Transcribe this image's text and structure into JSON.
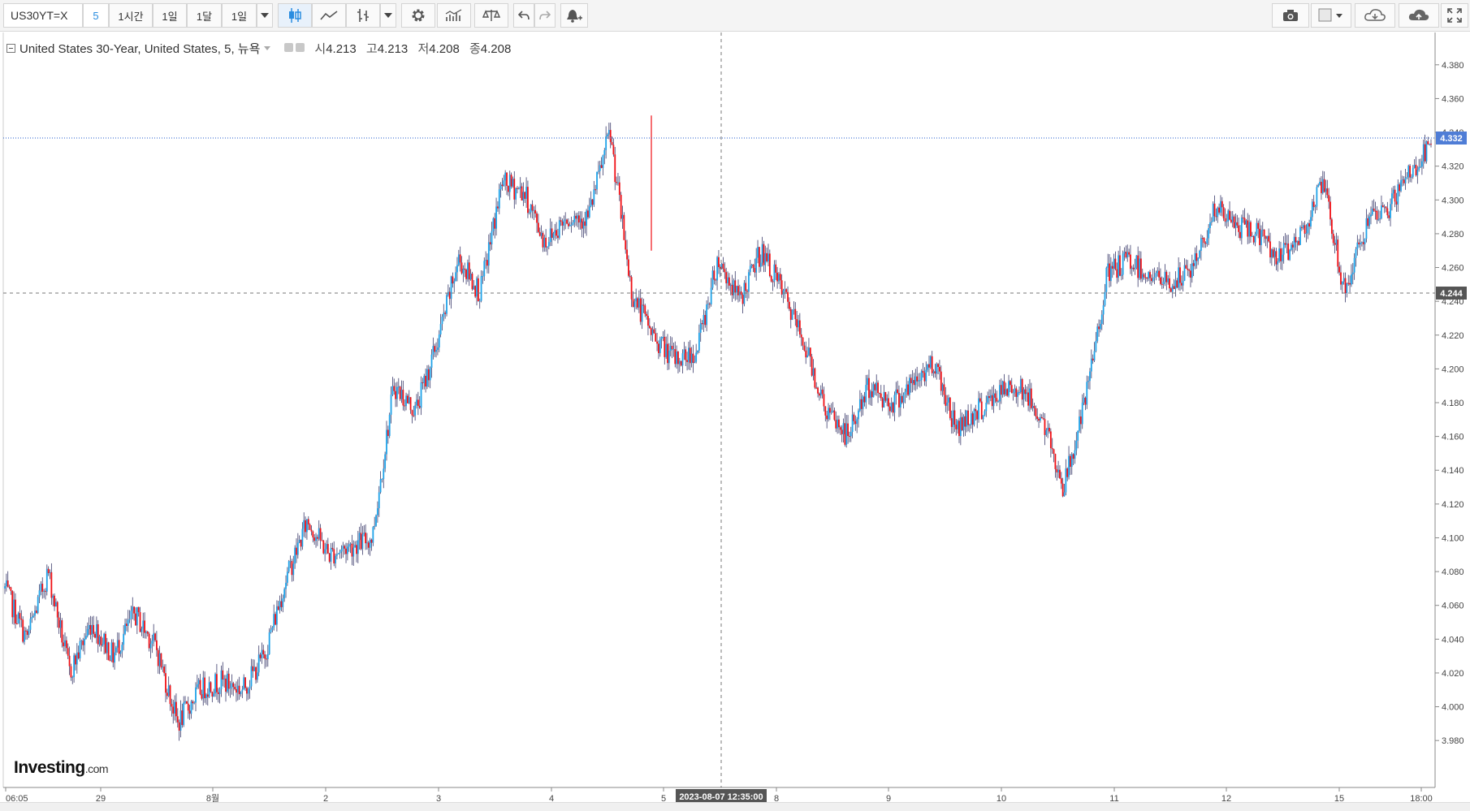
{
  "toolbar": {
    "symbol": "US30YT=X",
    "interval_active": "5",
    "intervals": [
      "1시간",
      "1일",
      "1달",
      "1일"
    ]
  },
  "legend": {
    "title": "United States 30-Year, United States, 5, 뉴욕",
    "open_label": "시",
    "open": "4.213",
    "high_label": "고",
    "high": "4.213",
    "low_label": "저",
    "low": "4.208",
    "close_label": "종",
    "close": "4.208"
  },
  "crosshair": {
    "date_label": "2023-08-07 12:35:00",
    "price_label": "4.244"
  },
  "last_price": "4.332",
  "logo": {
    "main": "Investing",
    "suffix": ".com"
  },
  "colors": {
    "up": "#1ea2e8",
    "down": "#f00f14",
    "wick": "#3b3b6b",
    "last_price_bg": "#4f7dd6",
    "crosshair_bg": "#555555"
  },
  "chart_data": {
    "type": "candlestick",
    "ylim": [
      3.97,
      4.39
    ],
    "y_ticks": [
      "4.380",
      "4.360",
      "4.340",
      "4.320",
      "4.300",
      "4.280",
      "4.260",
      "4.240",
      "4.220",
      "4.200",
      "4.180",
      "4.160",
      "4.140",
      "4.120",
      "4.100",
      "4.080",
      "4.060",
      "4.040",
      "4.020",
      "4.000",
      "3.980"
    ],
    "x_ticks": [
      "06:05",
      "29",
      "8월",
      "2",
      "3",
      "4",
      "5",
      "8",
      "9",
      "10",
      "11",
      "12",
      "15",
      "18:00"
    ],
    "price_path": [
      {
        "x": "07-28 06:05",
        "y": 4.07
      },
      {
        "x": "07-28",
        "y": 4.04
      },
      {
        "x": "07-28",
        "y": 4.08
      },
      {
        "x": "29",
        "y": 4.02
      },
      {
        "x": "29",
        "y": 4.05
      },
      {
        "x": "29",
        "y": 4.03
      },
      {
        "x": "29",
        "y": 4.055
      },
      {
        "x": "8월",
        "y": 4.035
      },
      {
        "x": "8월",
        "y": 3.99
      },
      {
        "x": "8월",
        "y": 4.01
      },
      {
        "x": "8월",
        "y": 4.015
      },
      {
        "x": "2",
        "y": 4.01
      },
      {
        "x": "2",
        "y": 4.03
      },
      {
        "x": "2",
        "y": 4.075
      },
      {
        "x": "2",
        "y": 4.11
      },
      {
        "x": "2",
        "y": 4.09
      },
      {
        "x": "2",
        "y": 4.095
      },
      {
        "x": "3",
        "y": 4.1
      },
      {
        "x": "3",
        "y": 4.19
      },
      {
        "x": "3",
        "y": 4.175
      },
      {
        "x": "3",
        "y": 4.215
      },
      {
        "x": "3",
        "y": 4.265
      },
      {
        "x": "3",
        "y": 4.245
      },
      {
        "x": "4",
        "y": 4.31
      },
      {
        "x": "4",
        "y": 4.305
      },
      {
        "x": "4",
        "y": 4.275
      },
      {
        "x": "4",
        "y": 4.29
      },
      {
        "x": "5",
        "y": 4.29
      },
      {
        "x": "5",
        "y": 4.34
      },
      {
        "x": "5",
        "y": 4.245
      },
      {
        "x": "5",
        "y": 4.22
      },
      {
        "x": "5",
        "y": 4.205
      },
      {
        "x": "8",
        "y": 4.21
      },
      {
        "x": "8",
        "y": 4.265
      },
      {
        "x": "8",
        "y": 4.24
      },
      {
        "x": "8",
        "y": 4.27
      },
      {
        "x": "8",
        "y": 4.245
      },
      {
        "x": "8",
        "y": 4.215
      },
      {
        "x": "9",
        "y": 4.175
      },
      {
        "x": "9",
        "y": 4.16
      },
      {
        "x": "9",
        "y": 4.19
      },
      {
        "x": "9",
        "y": 4.18
      },
      {
        "x": "9",
        "y": 4.19
      },
      {
        "x": "10",
        "y": 4.205
      },
      {
        "x": "10",
        "y": 4.165
      },
      {
        "x": "10",
        "y": 4.175
      },
      {
        "x": "10",
        "y": 4.185
      },
      {
        "x": "10",
        "y": 4.19
      },
      {
        "x": "11",
        "y": 4.17
      },
      {
        "x": "11",
        "y": 4.13
      },
      {
        "x": "11",
        "y": 4.18
      },
      {
        "x": "11",
        "y": 4.255
      },
      {
        "x": "11",
        "y": 4.265
      },
      {
        "x": "11",
        "y": 4.255
      },
      {
        "x": "11",
        "y": 4.25
      },
      {
        "x": "12",
        "y": 4.26
      },
      {
        "x": "12",
        "y": 4.295
      },
      {
        "x": "12",
        "y": 4.285
      },
      {
        "x": "12",
        "y": 4.28
      },
      {
        "x": "15",
        "y": 4.265
      },
      {
        "x": "15",
        "y": 4.28
      },
      {
        "x": "15",
        "y": 4.31
      },
      {
        "x": "15",
        "y": 4.245
      },
      {
        "x": "15",
        "y": 4.285
      },
      {
        "x": "15",
        "y": 4.295
      },
      {
        "x": "18:00",
        "y": 4.315
      },
      {
        "x": "18:00",
        "y": 4.332
      }
    ]
  }
}
